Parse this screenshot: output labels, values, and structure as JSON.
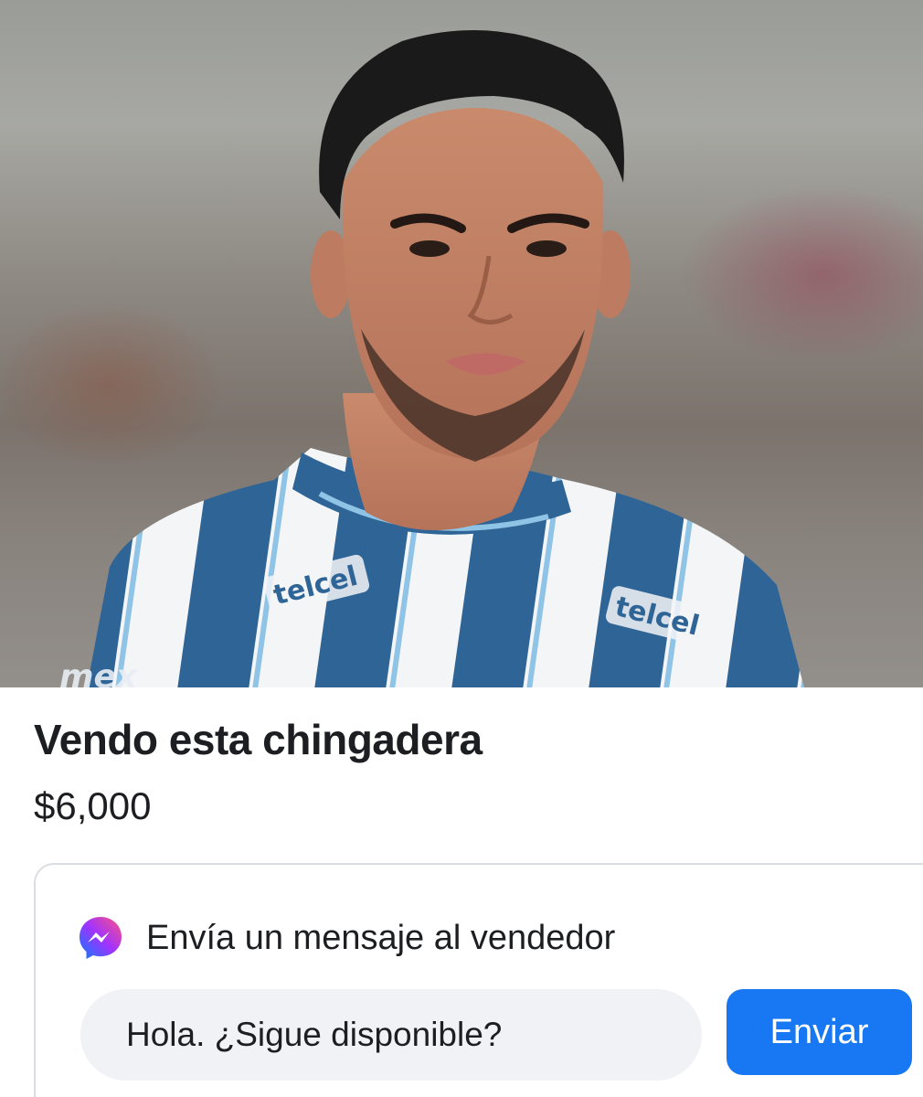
{
  "listing": {
    "title": "Vendo esta chingadera",
    "price": "$6,000",
    "photo": {
      "jersey_sponsor_left": "telcel",
      "jersey_sponsor_right": "telcel",
      "jersey_text_partial": "mex"
    }
  },
  "message_card": {
    "header": "Envía un mensaje al vendedor",
    "icon": "messenger-icon",
    "input_value": "Hola. ¿Sigue disponible?",
    "send_label": "Enviar"
  },
  "colors": {
    "accent": "#1877f2",
    "input_bg": "#f0f2f5",
    "text": "#1c1e21",
    "jersey_blue": "#2f6496"
  }
}
